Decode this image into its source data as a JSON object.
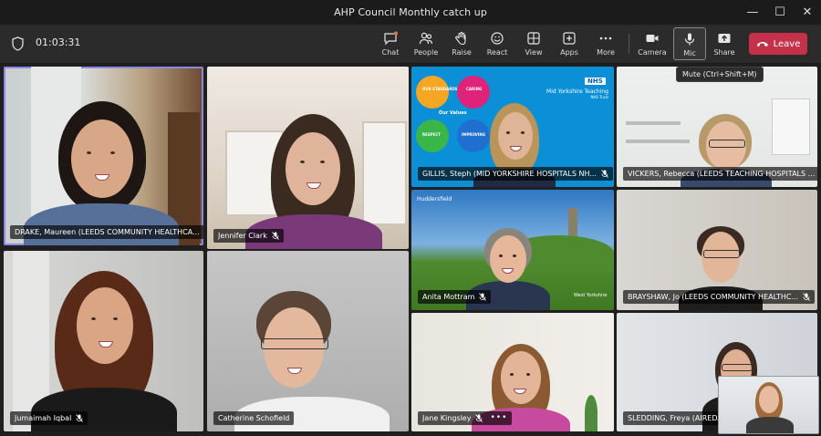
{
  "window": {
    "title": "AHP Council Monthly catch up",
    "controls": [
      "—",
      "☐",
      "✕"
    ]
  },
  "toolbar": {
    "timer": "01:03:31",
    "buttons": [
      {
        "label": "Chat",
        "icon": "chat-icon"
      },
      {
        "label": "People",
        "icon": "people-icon"
      },
      {
        "label": "Raise",
        "icon": "raise-hand-icon"
      },
      {
        "label": "React",
        "icon": "react-icon"
      },
      {
        "label": "View",
        "icon": "view-icon"
      },
      {
        "label": "Apps",
        "icon": "apps-icon"
      },
      {
        "label": "More",
        "icon": "more-icon"
      },
      {
        "label": "Camera",
        "icon": "camera-icon"
      },
      {
        "label": "Mic",
        "icon": "mic-icon"
      },
      {
        "label": "Share",
        "icon": "share-icon"
      }
    ],
    "leave_label": "Leave",
    "mic_tooltip": "Mute (Ctrl+Shift+M)"
  },
  "participants": [
    {
      "name": "DRAKE, Maureen (LEEDS COMMUNITY HEALTHCA...",
      "muted": false
    },
    {
      "name": "Jennifer Clark",
      "muted": true
    },
    {
      "name": "GILLIS, Steph (MID YORKSHIRE HOSPITALS NH...",
      "muted": true
    },
    {
      "name": "VICKERS, Rebecca (LEEDS TEACHING HOSPITALS N...",
      "muted": false
    },
    {
      "name": "Anita Mottram",
      "muted": true
    },
    {
      "name": "BRAYSHAW, Jo (LEEDS COMMUNITY HEALTHC...",
      "muted": true
    },
    {
      "name": "Jumaimah Iqbal",
      "muted": true
    },
    {
      "name": "Catherine Schofield",
      "muted": false
    },
    {
      "name": "Jane Kingsley",
      "muted": true
    },
    {
      "name": "SLEDDING, Freya (AIREDALE NHS FOUNDATION T...",
      "muted": false
    }
  ],
  "backgrounds": {
    "huddersfield_label": "Huddersfield",
    "nhs_badge": "NHS",
    "trust_name": "Mid Yorkshire Teaching",
    "trust_sub": "NHS Trust",
    "values_center": "Our Values",
    "values": [
      "OUR STANDARDS",
      "CARING",
      "RESPECT",
      "IMPROVING"
    ],
    "watermark": "West Yorkshire"
  },
  "colors": {
    "leave": "#c4314b",
    "active_speaker": "#8f86e3"
  }
}
